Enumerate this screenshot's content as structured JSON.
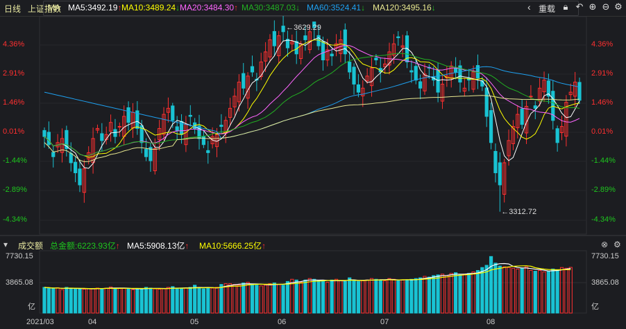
{
  "topbar": {
    "period": "日线",
    "index_name": "上证指数",
    "ma_label": "MA",
    "ma": [
      {
        "label": "MA5:3492.19",
        "arrow": "↑",
        "color": "#ffffff",
        "arrow_color": "#ff3030"
      },
      {
        "label": "MA10:3489.24",
        "arrow": "↓",
        "color": "#ffff00",
        "arrow_color": "#1ec61e"
      },
      {
        "label": "MA20:3484.30",
        "arrow": "↑",
        "color": "#ff66ff",
        "arrow_color": "#ff3030"
      },
      {
        "label": "MA30:3487.03",
        "arrow": "↓",
        "color": "#22b022",
        "arrow_color": "#1ec61e"
      },
      {
        "label": "MA60:3524.41",
        "arrow": "↓",
        "color": "#1ea0f0",
        "arrow_color": "#1ec61e"
      },
      {
        "label": "MA120:3495.16",
        "arrow": "↓",
        "color": "#e8e890",
        "arrow_color": "#1ec61e"
      }
    ],
    "prev": "‹",
    "reload": "重载"
  },
  "price_axis": [
    "4.36%",
    "2.91%",
    "1.46%",
    "0.01%",
    "-1.44%",
    "-2.89%",
    "-4.34%"
  ],
  "annotations": {
    "high": "←3629.29",
    "low": "←3312.72"
  },
  "volume": {
    "title": "成交额",
    "total": "总金额:6223.93亿",
    "total_arrow": "↑",
    "ma5": "MA5:5908.13亿",
    "ma5_arrow": "↑",
    "ma10": "MA10:5666.25亿",
    "ma10_arrow": "↑",
    "axis_top": "7730.15",
    "axis_mid": "3865.08",
    "axis_unit": "亿"
  },
  "dates": [
    "2021/03",
    "04",
    "05",
    "06",
    "07",
    "08"
  ],
  "colors": {
    "up": "#ff3030",
    "down": "#19c3d3",
    "bg": "#1c1d21"
  },
  "series": {
    "close_pct": [
      -0.2,
      -0.6,
      -1.2,
      -0.5,
      -0.3,
      -0.8,
      -1.5,
      -2.0,
      -2.6,
      -1.8,
      -1.0,
      -0.3,
      0.2,
      -0.4,
      -0.1,
      0.5,
      -0.2,
      0.3,
      0.8,
      0.5,
      1.0,
      0.2,
      -0.5,
      -1.2,
      -1.4,
      -0.8,
      0.2,
      0.9,
      1.2,
      0.6,
      0.1,
      -0.1,
      0.4,
      0.8,
      0.2,
      -0.3,
      -0.6,
      -1.0,
      -0.2,
      -0.1,
      0.3,
      0.6,
      1.2,
      1.8,
      2.5,
      2.2,
      2.8,
      3.0,
      2.6,
      3.5,
      4.0,
      4.6,
      4.3,
      4.8,
      5.0,
      4.2,
      4.5,
      3.9,
      4.4,
      4.6,
      5.0,
      5.2,
      4.3,
      3.6,
      4.1,
      3.8,
      4.4,
      4.6,
      3.9,
      3.0,
      2.4,
      2.0,
      2.2,
      2.8,
      3.2,
      3.6,
      3.0,
      3.4,
      4.0,
      4.4,
      4.7,
      4.3,
      3.5,
      3.0,
      2.6,
      2.2,
      2.9,
      3.2,
      2.6,
      2.0,
      2.4,
      2.8,
      3.3,
      3.0,
      2.5,
      2.2,
      2.6,
      3.0,
      2.7,
      2.3,
      0.8,
      -0.5,
      -2.0,
      -2.6,
      -1.5,
      -0.4,
      0.3,
      0.9,
      0.4,
      1.3,
      1.8,
      1.2,
      2.2,
      2.6,
      1.8,
      0.6,
      -0.5,
      0.3,
      1.5,
      2.0,
      2.5,
      1.6
    ],
    "volume": [
      3500,
      3400,
      3300,
      3450,
      3200,
      3500,
      3400,
      3300,
      3300,
      3250,
      3300,
      3350,
      3400,
      3350,
      3400,
      3550,
      3300,
      3400,
      3350,
      3300,
      3200,
      3300,
      3350,
      3500,
      3400,
      3300,
      3250,
      3300,
      3500,
      3600,
      3300,
      3350,
      3400,
      3500,
      3800,
      3400,
      3300,
      3450,
      3400,
      3500,
      3900,
      4000,
      4000,
      3900,
      3800,
      4100,
      4200,
      3900,
      3800,
      3700,
      3800,
      4000,
      4100,
      3900,
      3800,
      4300,
      4600,
      4500,
      4200,
      4500,
      4700,
      4600,
      4400,
      4300,
      4200,
      4500,
      4600,
      4400,
      4300,
      4800,
      4500,
      4300,
      4400,
      4500,
      4700,
      4600,
      4500,
      4400,
      4700,
      4600,
      4400,
      4500,
      4500,
      4600,
      4700,
      4800,
      5000,
      4900,
      5100,
      5200,
      5300,
      5100,
      5400,
      5500,
      5200,
      5300,
      5400,
      5600,
      5800,
      6200,
      6500,
      7700,
      6800,
      6400,
      6300,
      6200,
      6100,
      6000,
      6100,
      6300,
      5800,
      5700,
      5800,
      5600,
      5700,
      6000,
      5900,
      6200,
      6100,
      6224
    ]
  }
}
